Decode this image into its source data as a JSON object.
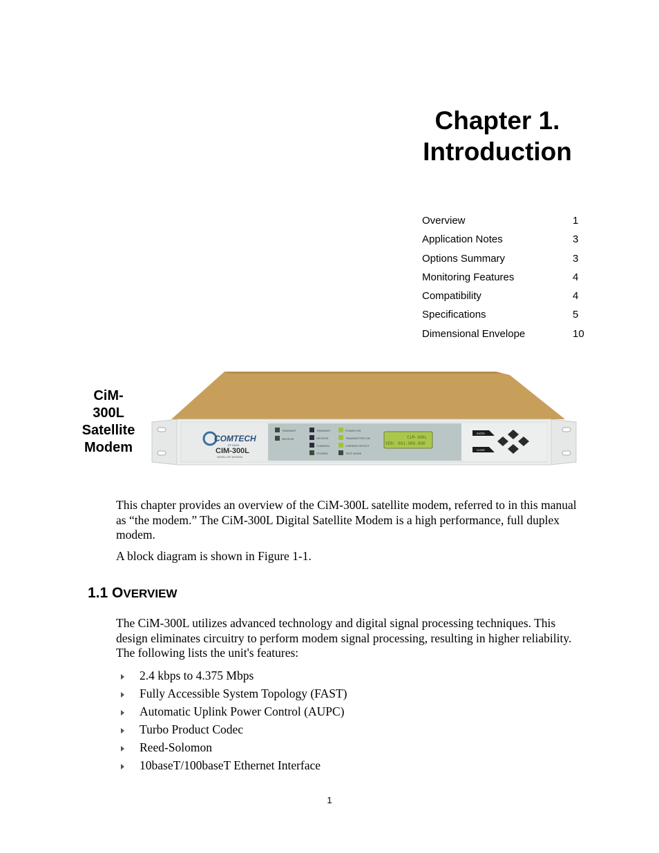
{
  "chapter": {
    "title_line1": "Chapter 1.",
    "title_line2": "Introduction"
  },
  "toc": [
    {
      "label": "Overview",
      "page": "1"
    },
    {
      "label": "Application Notes",
      "page": "3"
    },
    {
      "label": "Options Summary",
      "page": "3"
    },
    {
      "label": "Monitoring Features",
      "page": "4"
    },
    {
      "label": "Compatibility",
      "page": "4"
    },
    {
      "label": "Specifications",
      "page": "5"
    },
    {
      "label": "Dimensional Envelope",
      "page": "10"
    }
  ],
  "figure": {
    "caption_lines": [
      "CiM-",
      "300L",
      "Satellite",
      "Modem"
    ],
    "photo": {
      "brand": "COMTECH",
      "brand_sub": "EF DATA",
      "model": "CIM-300L",
      "model_sub": "SATELLITE MODEM",
      "alarm_leds": [
        "TRANSMIT",
        "RECEIVE"
      ],
      "fault_leds": [
        "TRANSMIT",
        "RECEIVE",
        "COMMON",
        "STORED"
      ],
      "status_leds": [
        "POWER ON",
        "TRANSMITTER ON",
        "CARRIER DETECT",
        "TEST MODE"
      ],
      "lcd_line1": "CiM-300L",
      "lcd_line2": "VER: 001.000.000",
      "buttons": [
        "ENTER",
        "CLEAR"
      ],
      "colors": {
        "chassis": "#c9a25e",
        "panel": "#e8eaea",
        "led_panel": "#b9c6c6",
        "lcd": "#a9c84a"
      }
    }
  },
  "body": {
    "intro_p1": "This chapter provides an overview of the CiM-300L satellite modem, referred to in this manual as “the modem.” The CiM-300L Digital Satellite Modem is a high performance, full duplex modem.",
    "intro_p2": "A block diagram is shown in Figure 1-1.",
    "section_number": "1.1 ",
    "section_title_first": "O",
    "section_title_rest": "VERVIEW",
    "overview_p1": "The CiM-300L utilizes advanced technology and digital signal processing techniques. This design eliminates circuitry to perform modem signal processing, resulting in higher reliability. The following lists the unit's features:",
    "features": [
      "2.4 kbps to 4.375 Mbps",
      "Fully Accessible System Topology (FAST)",
      "Automatic Uplink Power Control (AUPC)",
      "Turbo Product Codec",
      "Reed-Solomon",
      "10baseT/100baseT Ethernet Interface"
    ]
  },
  "footer": {
    "page_number": "1"
  }
}
